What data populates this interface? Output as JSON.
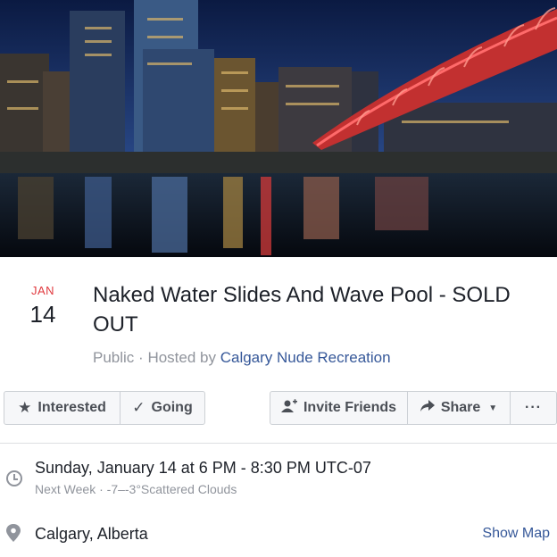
{
  "event": {
    "month": "JAN",
    "day": "14",
    "title": "Naked Water Slides And Wave Pool - SOLD OUT",
    "privacy": "Public",
    "hosted_by_prefix": "Hosted by",
    "host": "Calgary Nude Recreation"
  },
  "actions": {
    "interested": "Interested",
    "going": "Going",
    "invite": "Invite Friends",
    "share": "Share",
    "more": "···"
  },
  "details": {
    "time": "Sunday, January 14 at 6 PM - 8:30 PM UTC-07",
    "forecast": "Next Week · -7–-3°Scattered Clouds",
    "location": "Calgary, Alberta",
    "show_map": "Show Map"
  },
  "icons": {
    "interested": "star-icon",
    "going": "checkmark-icon",
    "invite": "add-person-icon",
    "share": "share-arrow-icon",
    "time": "clock-icon",
    "location": "map-pin-icon"
  },
  "colors": {
    "month_accent": "#e0393e",
    "link": "#365899",
    "muted": "#90949c"
  }
}
